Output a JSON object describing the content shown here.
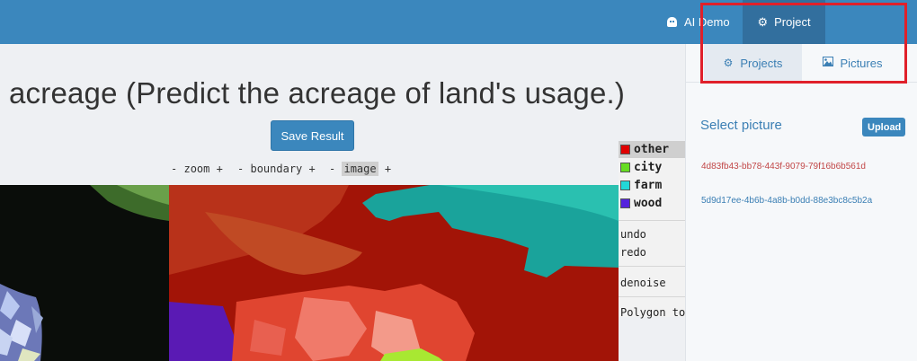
{
  "navbar": {
    "items": [
      {
        "label": "AI Demo",
        "icon": "android-icon"
      },
      {
        "label": "Project",
        "icon": "gear-icon",
        "active": true
      }
    ],
    "bg_color": "#3b87bd"
  },
  "main": {
    "title": "acreage (Predict the acreage of land's usage.)",
    "save_button": "Save Result",
    "controls": [
      {
        "minus": "-",
        "label": "zoom",
        "plus": "+"
      },
      {
        "minus": "-",
        "label": "boundary",
        "plus": "+"
      },
      {
        "minus": "-",
        "label": "image",
        "plus": "+",
        "active": true
      }
    ]
  },
  "legend": {
    "classes": [
      {
        "label": "other",
        "color": "#e00000",
        "active": true
      },
      {
        "label": "city",
        "color": "#66dd22"
      },
      {
        "label": "farm",
        "color": "#22d8d8"
      },
      {
        "label": "wood",
        "color": "#5522dd"
      }
    ],
    "tools": [
      "undo",
      "redo",
      "denoise",
      "Polygon tool"
    ]
  },
  "sidebar": {
    "tabs": [
      {
        "label": "Projects",
        "icon": "gears-icon",
        "active": true
      },
      {
        "label": "Pictures",
        "icon": "picture-icon"
      }
    ],
    "select_title": "Select picture",
    "upload_button": "Upload",
    "pictures": [
      {
        "id": "4d83fb43-bb78-443f-9079-79f16b6b561d",
        "color": "#c24848",
        "selected": true
      },
      {
        "id": "5d9d17ee-4b6b-4a8b-b0dd-88e3bc8c5b2a",
        "color": "#3b7fb4"
      }
    ]
  },
  "annotation": {
    "highlight_color": "#e0202a"
  }
}
